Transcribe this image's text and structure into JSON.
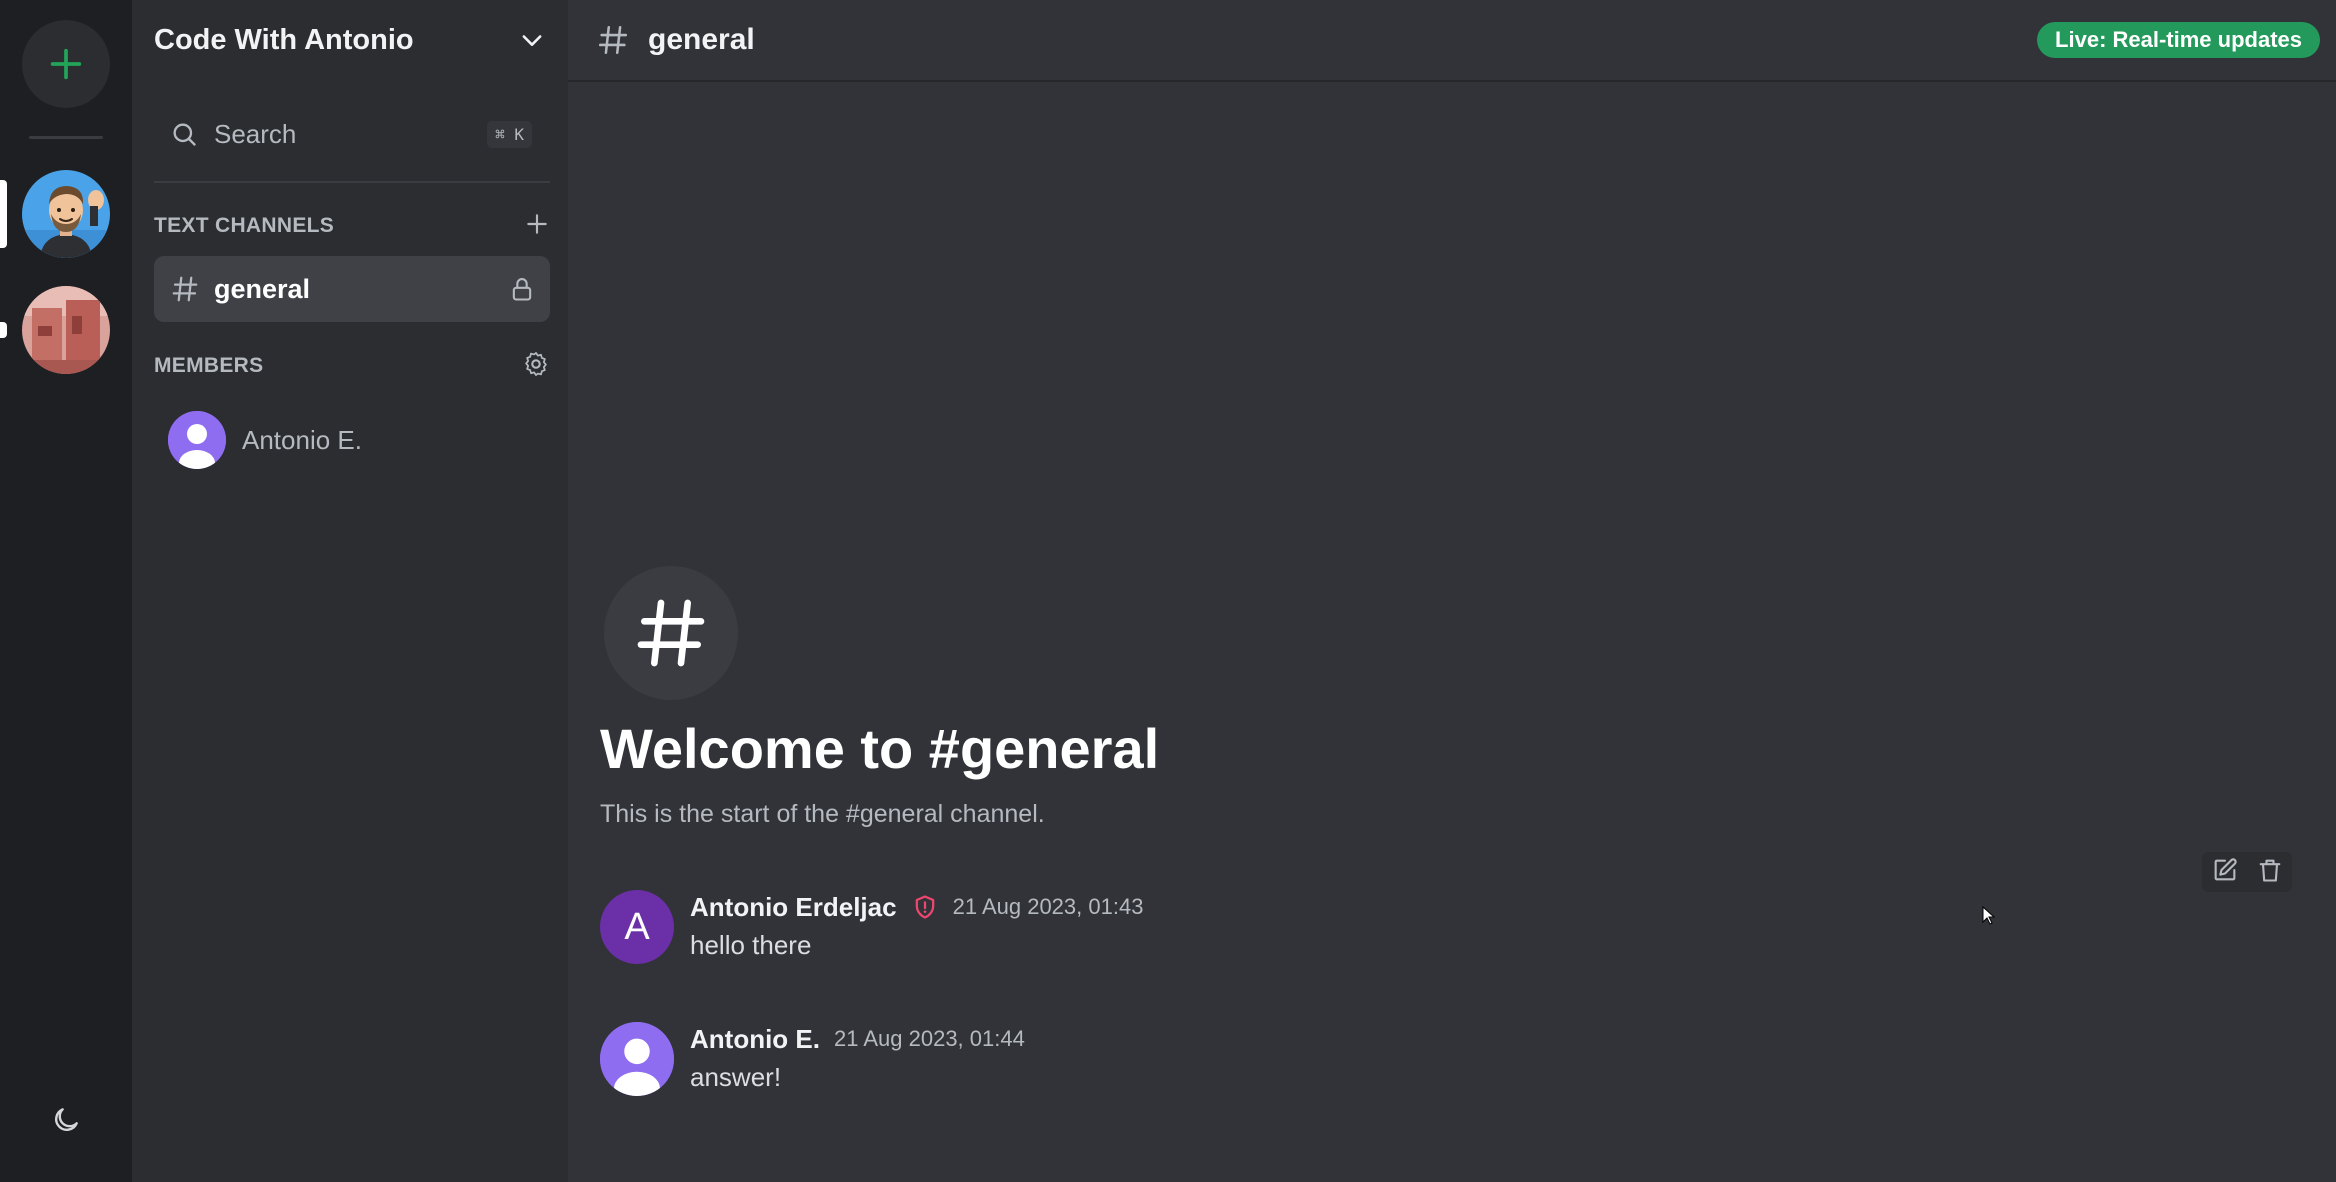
{
  "server": {
    "name": "Code With Antonio"
  },
  "search": {
    "label": "Search",
    "shortcut": "⌘ K"
  },
  "sections": {
    "text_channels": "TEXT CHANNELS",
    "members": "MEMBERS"
  },
  "channels": [
    {
      "name": "general",
      "active": true,
      "locked": true
    }
  ],
  "members": [
    {
      "name": "Antonio E."
    }
  ],
  "header": {
    "channel_name": "general",
    "live_badge": "Live: Real-time updates"
  },
  "welcome": {
    "title": "Welcome to #general",
    "subtitle": "This is the start of the #general channel."
  },
  "messages": [
    {
      "author": "Antonio Erdeljac",
      "avatar_letter": "A",
      "avatar_color": "#6b2fa8",
      "moderator": true,
      "timestamp": "21 Aug 2023, 01:43",
      "content": "hello there"
    },
    {
      "author": "Antonio E.",
      "avatar_letter": "",
      "avatar_color": "#8f6df0",
      "moderator": false,
      "timestamp": "21 Aug 2023, 01:44",
      "content": "answer!"
    }
  ],
  "colors": {
    "accent_green": "#23a559",
    "live_badge": "#239a5b",
    "moderator_shield": "#f0476f",
    "rail_bg": "#1e1f22",
    "sidebar_bg": "#2b2d31",
    "main_bg": "#313338"
  },
  "icons": {
    "add_server": "plus-icon",
    "server_dropdown": "chevron-down-icon",
    "search": "search-icon",
    "add_channel": "plus-icon",
    "channel": "hash-icon",
    "channel_locked": "lock-icon",
    "manage_members": "gear-icon",
    "theme": "moon-icon",
    "moderator": "shield-alert-icon",
    "edit": "edit-icon",
    "delete": "trash-icon"
  }
}
